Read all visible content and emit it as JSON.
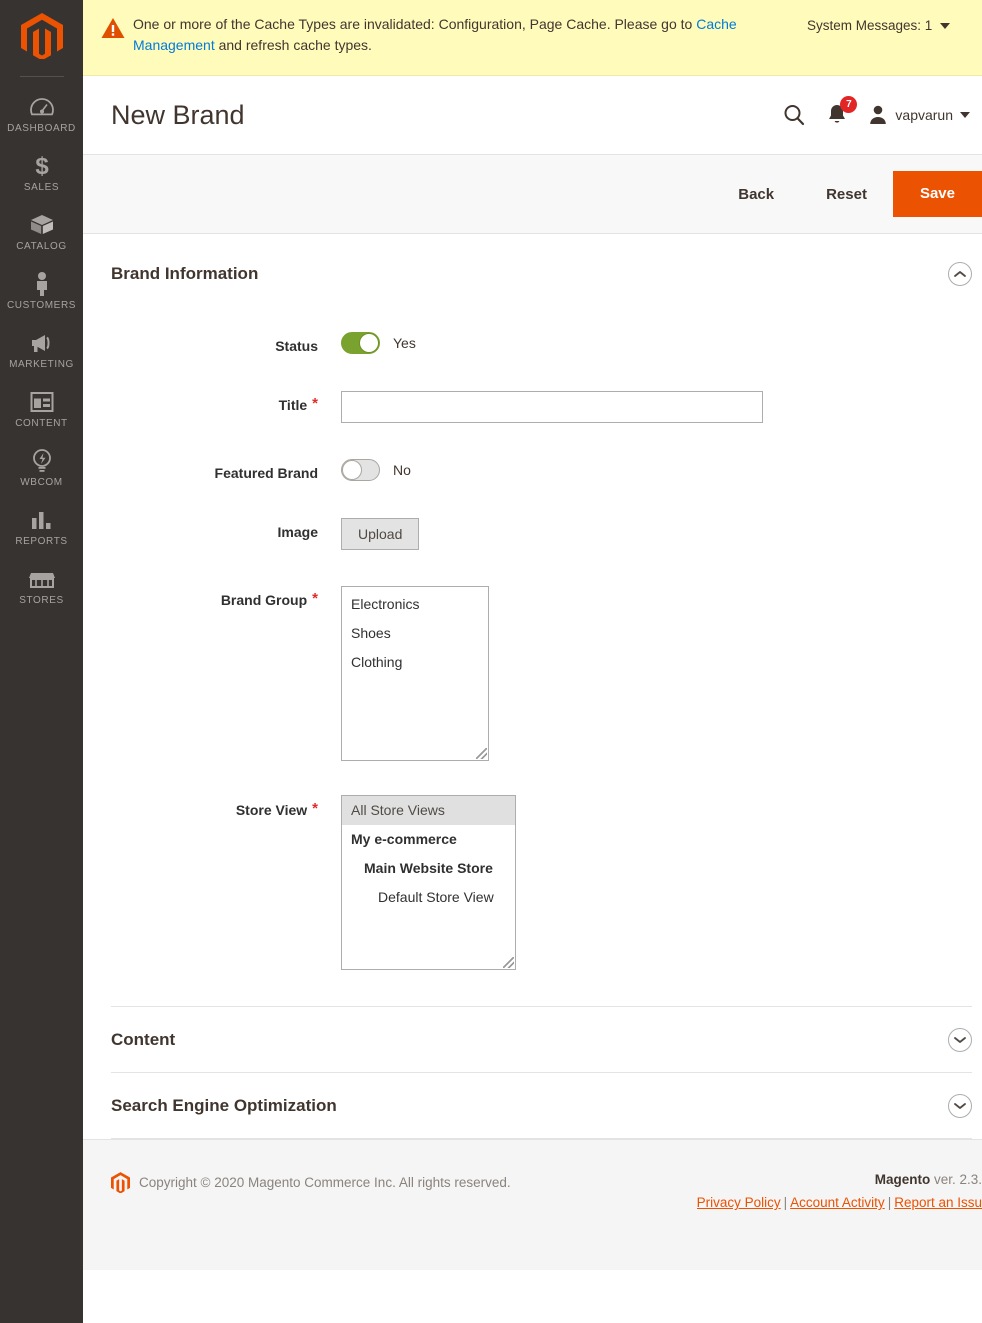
{
  "sidebar": {
    "logo_name": "magento-logo",
    "items": [
      {
        "label": "DASHBOARD",
        "icon": "dashboard-icon"
      },
      {
        "label": "SALES",
        "icon": "dollar-icon"
      },
      {
        "label": "CATALOG",
        "icon": "box-icon"
      },
      {
        "label": "CUSTOMERS",
        "icon": "person-icon"
      },
      {
        "label": "MARKETING",
        "icon": "megaphone-icon"
      },
      {
        "label": "CONTENT",
        "icon": "layout-icon"
      },
      {
        "label": "WBCOM",
        "icon": "lightbulb-icon"
      },
      {
        "label": "REPORTS",
        "icon": "bar-chart-icon"
      },
      {
        "label": "STORES",
        "icon": "storefront-icon"
      }
    ]
  },
  "system_message": {
    "icon": "warning-icon",
    "text_before": "One or more of the Cache Types are invalidated: Configuration, Page Cache. Please go to ",
    "link_text": "Cache Management",
    "text_after": " and refresh cache types.",
    "counter_label": "System Messages: 1"
  },
  "header": {
    "title": "New Brand",
    "search_icon": "search-icon",
    "notifications_icon": "bell-icon",
    "notifications_count": "7",
    "avatar_icon": "user-avatar-icon",
    "user_name": "vapvarun"
  },
  "toolbar": {
    "back_label": "Back",
    "reset_label": "Reset",
    "save_label": "Save"
  },
  "brand_information": {
    "section_title": "Brand Information",
    "collapse_icon": "chevron-up-icon",
    "fields": {
      "status": {
        "label": "Status",
        "value_text": "Yes",
        "on": true
      },
      "title": {
        "label": "Title",
        "required": "*",
        "value": "",
        "placeholder": ""
      },
      "featured_brand": {
        "label": "Featured Brand",
        "value_text": "No",
        "on": false
      },
      "image": {
        "label": "Image",
        "upload_label": "Upload"
      },
      "brand_group": {
        "label": "Brand Group",
        "required": "*",
        "options": [
          "Electronics",
          "Shoes",
          "Clothing"
        ]
      },
      "store_view": {
        "label": "Store View",
        "required": "*",
        "options": [
          {
            "text": "All Store Views",
            "level": 0,
            "selected": true
          },
          {
            "text": "My e-commerce",
            "level": 0,
            "selected": false,
            "group": true
          },
          {
            "text": "Main Website Store",
            "level": 1,
            "selected": false
          },
          {
            "text": "Default Store View",
            "level": 2,
            "selected": false
          }
        ]
      }
    }
  },
  "sections": [
    {
      "title": "Content",
      "expand_icon": "chevron-down-icon"
    },
    {
      "title": "Search Engine Optimization",
      "expand_icon": "chevron-down-icon"
    }
  ],
  "footer": {
    "logo_icon": "magento-logo-small",
    "copyright": "Copyright © 2020 Magento Commerce Inc. All rights reserved.",
    "product_name": "Magento",
    "version": "ver. 2.3.",
    "links": [
      "Privacy Policy",
      "Account Activity",
      "Report an Issu"
    ]
  },
  "colors": {
    "accent_orange": "#eb5202",
    "sidebar_bg": "#373330",
    "message_bg": "#fffbbb",
    "toggle_on_green": "#79a22e",
    "required_red": "#e02b27",
    "link_blue": "#007bdb"
  }
}
